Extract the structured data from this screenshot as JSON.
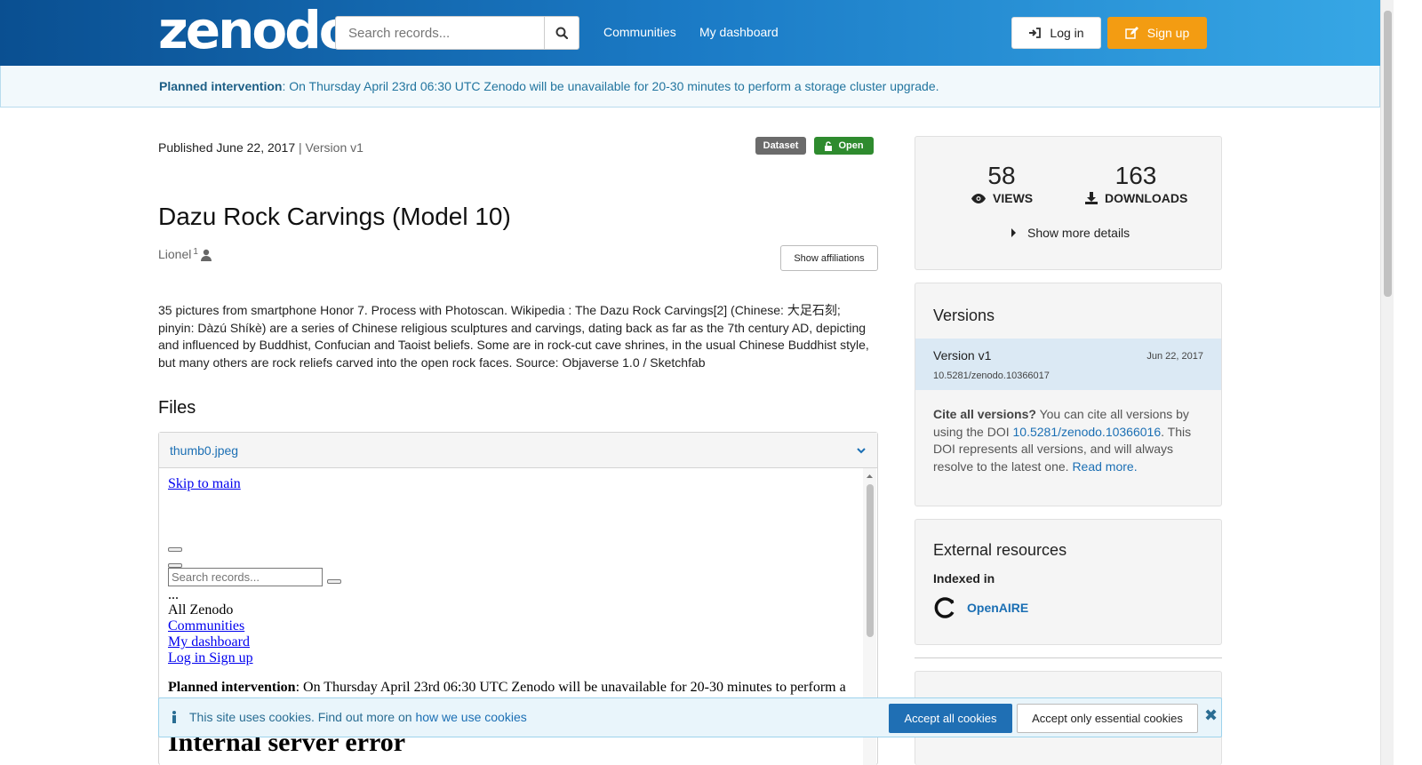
{
  "header": {
    "logo": "zenodo",
    "search_placeholder": "Search records...",
    "nav": [
      "Communities",
      "My dashboard"
    ],
    "login": "Log in",
    "signup": "Sign up"
  },
  "banner": {
    "bold": "Planned intervention",
    "text": ": On Thursday April 23rd 06:30 UTC Zenodo will be unavailable for 20-30 minutes to perform a storage cluster upgrade."
  },
  "record": {
    "published": "Published June 22, 2017",
    "version": " | Version v1",
    "badge_type": "Dataset",
    "badge_access": "Open",
    "title": "Dazu Rock Carvings (Model 10)",
    "author": "Lionel",
    "author_sup": "1",
    "show_affiliations": "Show affiliations",
    "description": "35 pictures from smartphone Honor 7. Process with Photoscan. Wikipedia : The Dazu Rock Carvings[2] (Chinese: 大足石刻; pinyin: Dàzú Shíkè) are a series of Chinese religious sculptures and carvings, dating back as far as the 7th century AD, depicting and influenced by Buddhist, Confucian and Taoist beliefs. Some are in rock-cut cave shrines, in the usual Chinese Buddhist style, but many others are rock reliefs carved into the open rock faces. Source: Objaverse 1.0 / Sketchfab",
    "files_heading": "Files",
    "file_name": "thumb0.jpeg"
  },
  "preview": {
    "skip": "Skip to main",
    "search_placeholder": "Search records...",
    "dots": "...",
    "all_zenodo": "All Zenodo",
    "communities": "Communities",
    "dashboard": "My dashboard",
    "login_signup": "Log in Sign up",
    "planned_bold": "Planned intervention",
    "planned_text": ": On Thursday April 23rd 06:30 UTC Zenodo will be unavailable for 20-30 minutes to perform a",
    "error": "Internal server error"
  },
  "stats": {
    "views": "58",
    "views_label": "VIEWS",
    "downloads": "163",
    "downloads_label": "DOWNLOADS",
    "more": "Show more details"
  },
  "versions": {
    "heading": "Versions",
    "name": "Version v1",
    "date": "Jun 22, 2017",
    "doi": "10.5281/zenodo.10366017",
    "cite_bold": "Cite all versions?",
    "cite_1": " You can cite all versions by using the DOI ",
    "cite_doi": "10.5281/zenodo.10366016",
    "cite_2": ". This DOI represents all versions, and will always resolve to the latest one. ",
    "read_more": "Read more."
  },
  "external": {
    "heading": "External resources",
    "indexed": "Indexed in",
    "openaire": "OpenAIRE"
  },
  "cookie": {
    "text": "This site uses cookies. Find out more on ",
    "link": "how we use cookies",
    "accept_all": "Accept all cookies",
    "accept_essential": "Accept only essential cookies"
  },
  "colors": {
    "header_start": "#0a4f91",
    "header_end": "#37a8e6",
    "signup": "#f39c12",
    "open_badge": "#2e8b2e",
    "dataset_badge": "#6b6b6b",
    "link": "#1b6fb4"
  }
}
